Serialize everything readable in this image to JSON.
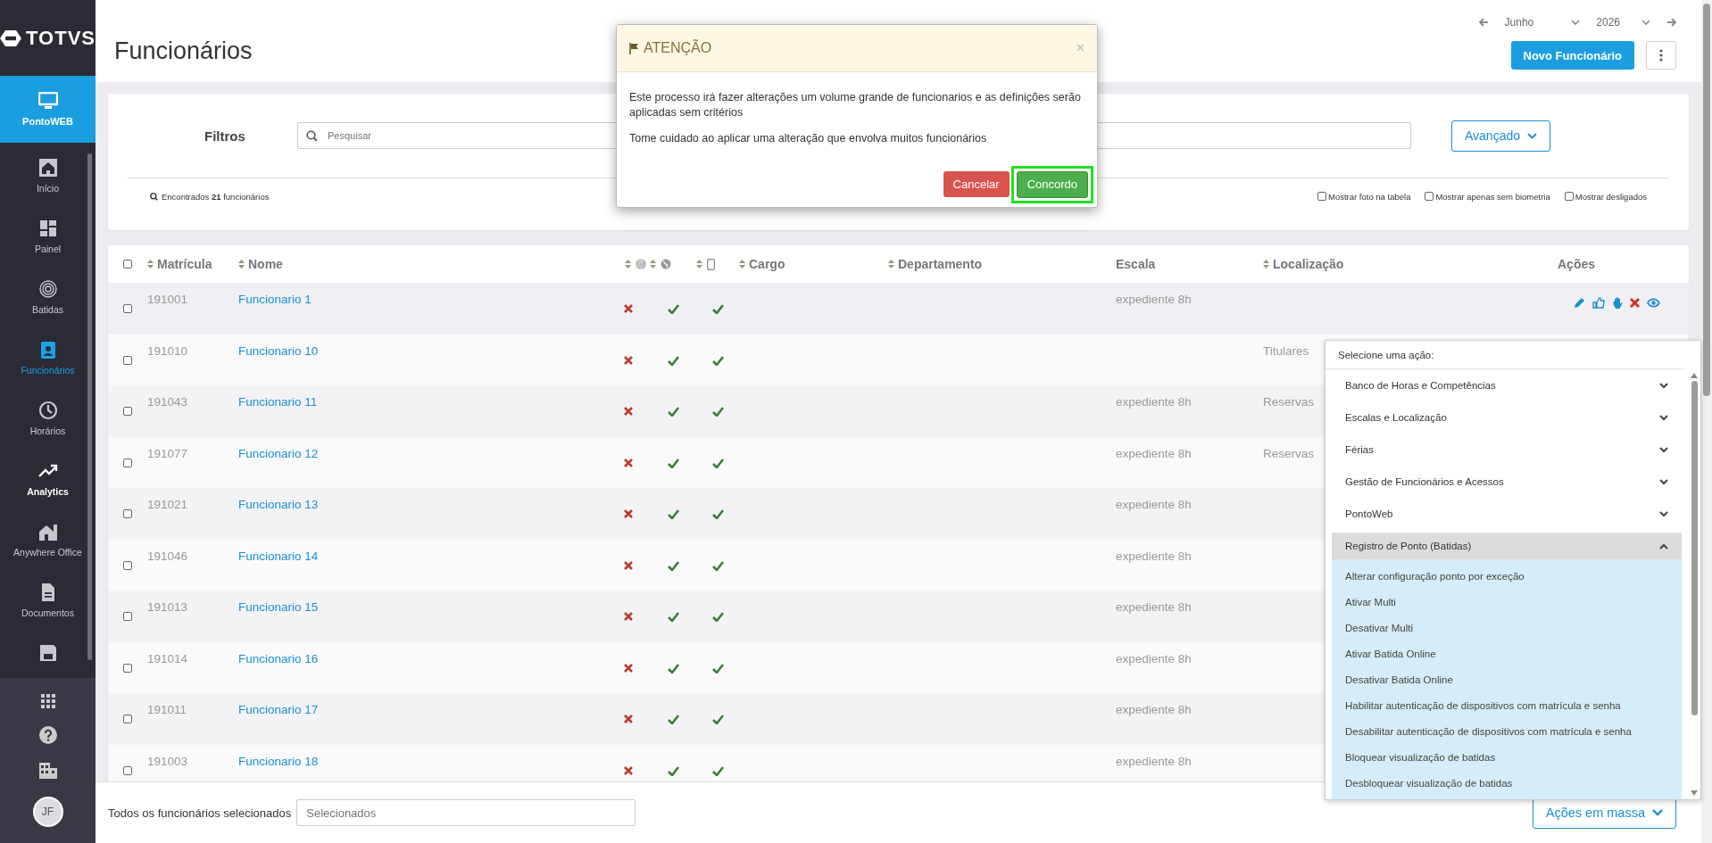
{
  "sidebar": {
    "logo": "TOTVS",
    "module": {
      "label": "PontoWEB",
      "selected": true
    },
    "items": [
      {
        "label": "Início",
        "kind": "home",
        "selected": false,
        "hovered": false
      },
      {
        "label": "Painel",
        "kind": "panel",
        "selected": false,
        "hovered": false
      },
      {
        "label": "Batidas",
        "kind": "finger",
        "selected": false,
        "hovered": false
      },
      {
        "label": "Funcionários",
        "kind": "badge",
        "selected": true,
        "hovered": false
      },
      {
        "label": "Horários",
        "kind": "clock",
        "selected": false,
        "hovered": false
      },
      {
        "label": "Analytics",
        "kind": "trend",
        "selected": false,
        "hovered": true
      },
      {
        "label": "Anywhere Office",
        "kind": "house",
        "selected": false,
        "hovered": false
      },
      {
        "label": "Documentos",
        "kind": "doc",
        "selected": false,
        "hovered": false
      },
      {
        "kind": "save",
        "selected": false,
        "hovered": false
      }
    ],
    "avatar": "JF"
  },
  "header": {
    "title": "Funcionários",
    "month": "Junho",
    "year": "2026",
    "new_button": "Novo Funcionário"
  },
  "filters": {
    "label": "Filtros",
    "search_placeholder": "Pesquisar",
    "advanced_button": "Avançado",
    "found": "Encontrados **21** funcionários",
    "options": [
      {
        "label": "Mostrar foto na tabela",
        "checked": false
      },
      {
        "label": "Mostrar apenas sem biometria",
        "checked": false
      },
      {
        "label": "Mostrar desligados",
        "checked": false
      }
    ]
  },
  "table": {
    "all_checked": false,
    "columns": [
      "Matrícula",
      "Nome",
      "Cargo",
      "Departamento",
      "Escala",
      "Localização",
      "Ações"
    ],
    "rows": [
      {
        "id": "191001",
        "name": "Funcionario 1",
        "biometry": false,
        "web": true,
        "mobile": true,
        "scale": "expediente 8h",
        "location": "",
        "checked": false,
        "hovered": true
      },
      {
        "id": "191010",
        "name": "Funcionario 10",
        "biometry": false,
        "web": true,
        "mobile": true,
        "scale": "",
        "location": "Titulares",
        "checked": false,
        "hovered": false
      },
      {
        "id": "191043",
        "name": "Funcionario 11",
        "biometry": false,
        "web": true,
        "mobile": true,
        "scale": "expediente 8h",
        "location": "Reservas",
        "checked": false,
        "hovered": false
      },
      {
        "id": "191077",
        "name": "Funcionario 12",
        "biometry": false,
        "web": true,
        "mobile": true,
        "scale": "expediente 8h",
        "location": "Reservas",
        "checked": false,
        "hovered": false
      },
      {
        "id": "191021",
        "name": "Funcionario 13",
        "biometry": false,
        "web": true,
        "mobile": true,
        "scale": "expediente 8h",
        "location": "",
        "checked": false,
        "hovered": false
      },
      {
        "id": "191046",
        "name": "Funcionario 14",
        "biometry": false,
        "web": true,
        "mobile": true,
        "scale": "expediente 8h",
        "location": "",
        "checked": false,
        "hovered": false
      },
      {
        "id": "191013",
        "name": "Funcionario 15",
        "biometry": false,
        "web": true,
        "mobile": true,
        "scale": "expediente 8h",
        "location": "",
        "checked": false,
        "hovered": false
      },
      {
        "id": "191014",
        "name": "Funcionario 16",
        "biometry": false,
        "web": true,
        "mobile": true,
        "scale": "expediente 8h",
        "location": "",
        "checked": false,
        "hovered": false
      },
      {
        "id": "191011",
        "name": "Funcionario 17",
        "biometry": false,
        "web": true,
        "mobile": true,
        "scale": "expediente 8h",
        "location": "",
        "checked": false,
        "hovered": false
      },
      {
        "id": "191003",
        "name": "Funcionario 18",
        "biometry": false,
        "web": true,
        "mobile": true,
        "scale": "expediente 8h",
        "location": "",
        "checked": false,
        "hovered": false
      }
    ]
  },
  "bottom_bar": {
    "label": "Todos os funcionários selecionados",
    "placeholder": "Selecionados",
    "mass_button": "Ações em massa"
  },
  "action_menu": {
    "title": "Selecione uma ação:",
    "groups": [
      {
        "label": "Banco de Horas e Competências",
        "expanded": false
      },
      {
        "label": "Escalas e Localização",
        "expanded": false
      },
      {
        "label": "Férias",
        "expanded": false
      },
      {
        "label": "Gestão de Funcionários e Acessos",
        "expanded": false
      },
      {
        "label": "PontoWeb",
        "expanded": false
      },
      {
        "label": "Registro de Ponto (Batidas)",
        "expanded": true,
        "children": [
          "Alterar configuração ponto por exceção",
          "Ativar Multi",
          "Desativar Multi",
          "Ativar Batida Online",
          "Desativar Batida Online",
          "Habilitar autenticação de dispositivos com matrícula e senha",
          "Desabilitar autenticação de dispositivos com matrícula e senha",
          "Bloquear visualização de batidas",
          "Desbloquear visualização de batidas"
        ]
      }
    ]
  },
  "modal": {
    "title": "ATENÇÃO",
    "close": "×",
    "paragraphs": [
      "Este processo irá fazer alterações um volume grande de funcionarios e as definições serão aplicadas sem critérios",
      "Tome cuidado ao aplicar uma alteração que envolva muitos funcionários"
    ],
    "cancel": "Cancelar",
    "agree": "Concordo",
    "agree_focused": true
  }
}
